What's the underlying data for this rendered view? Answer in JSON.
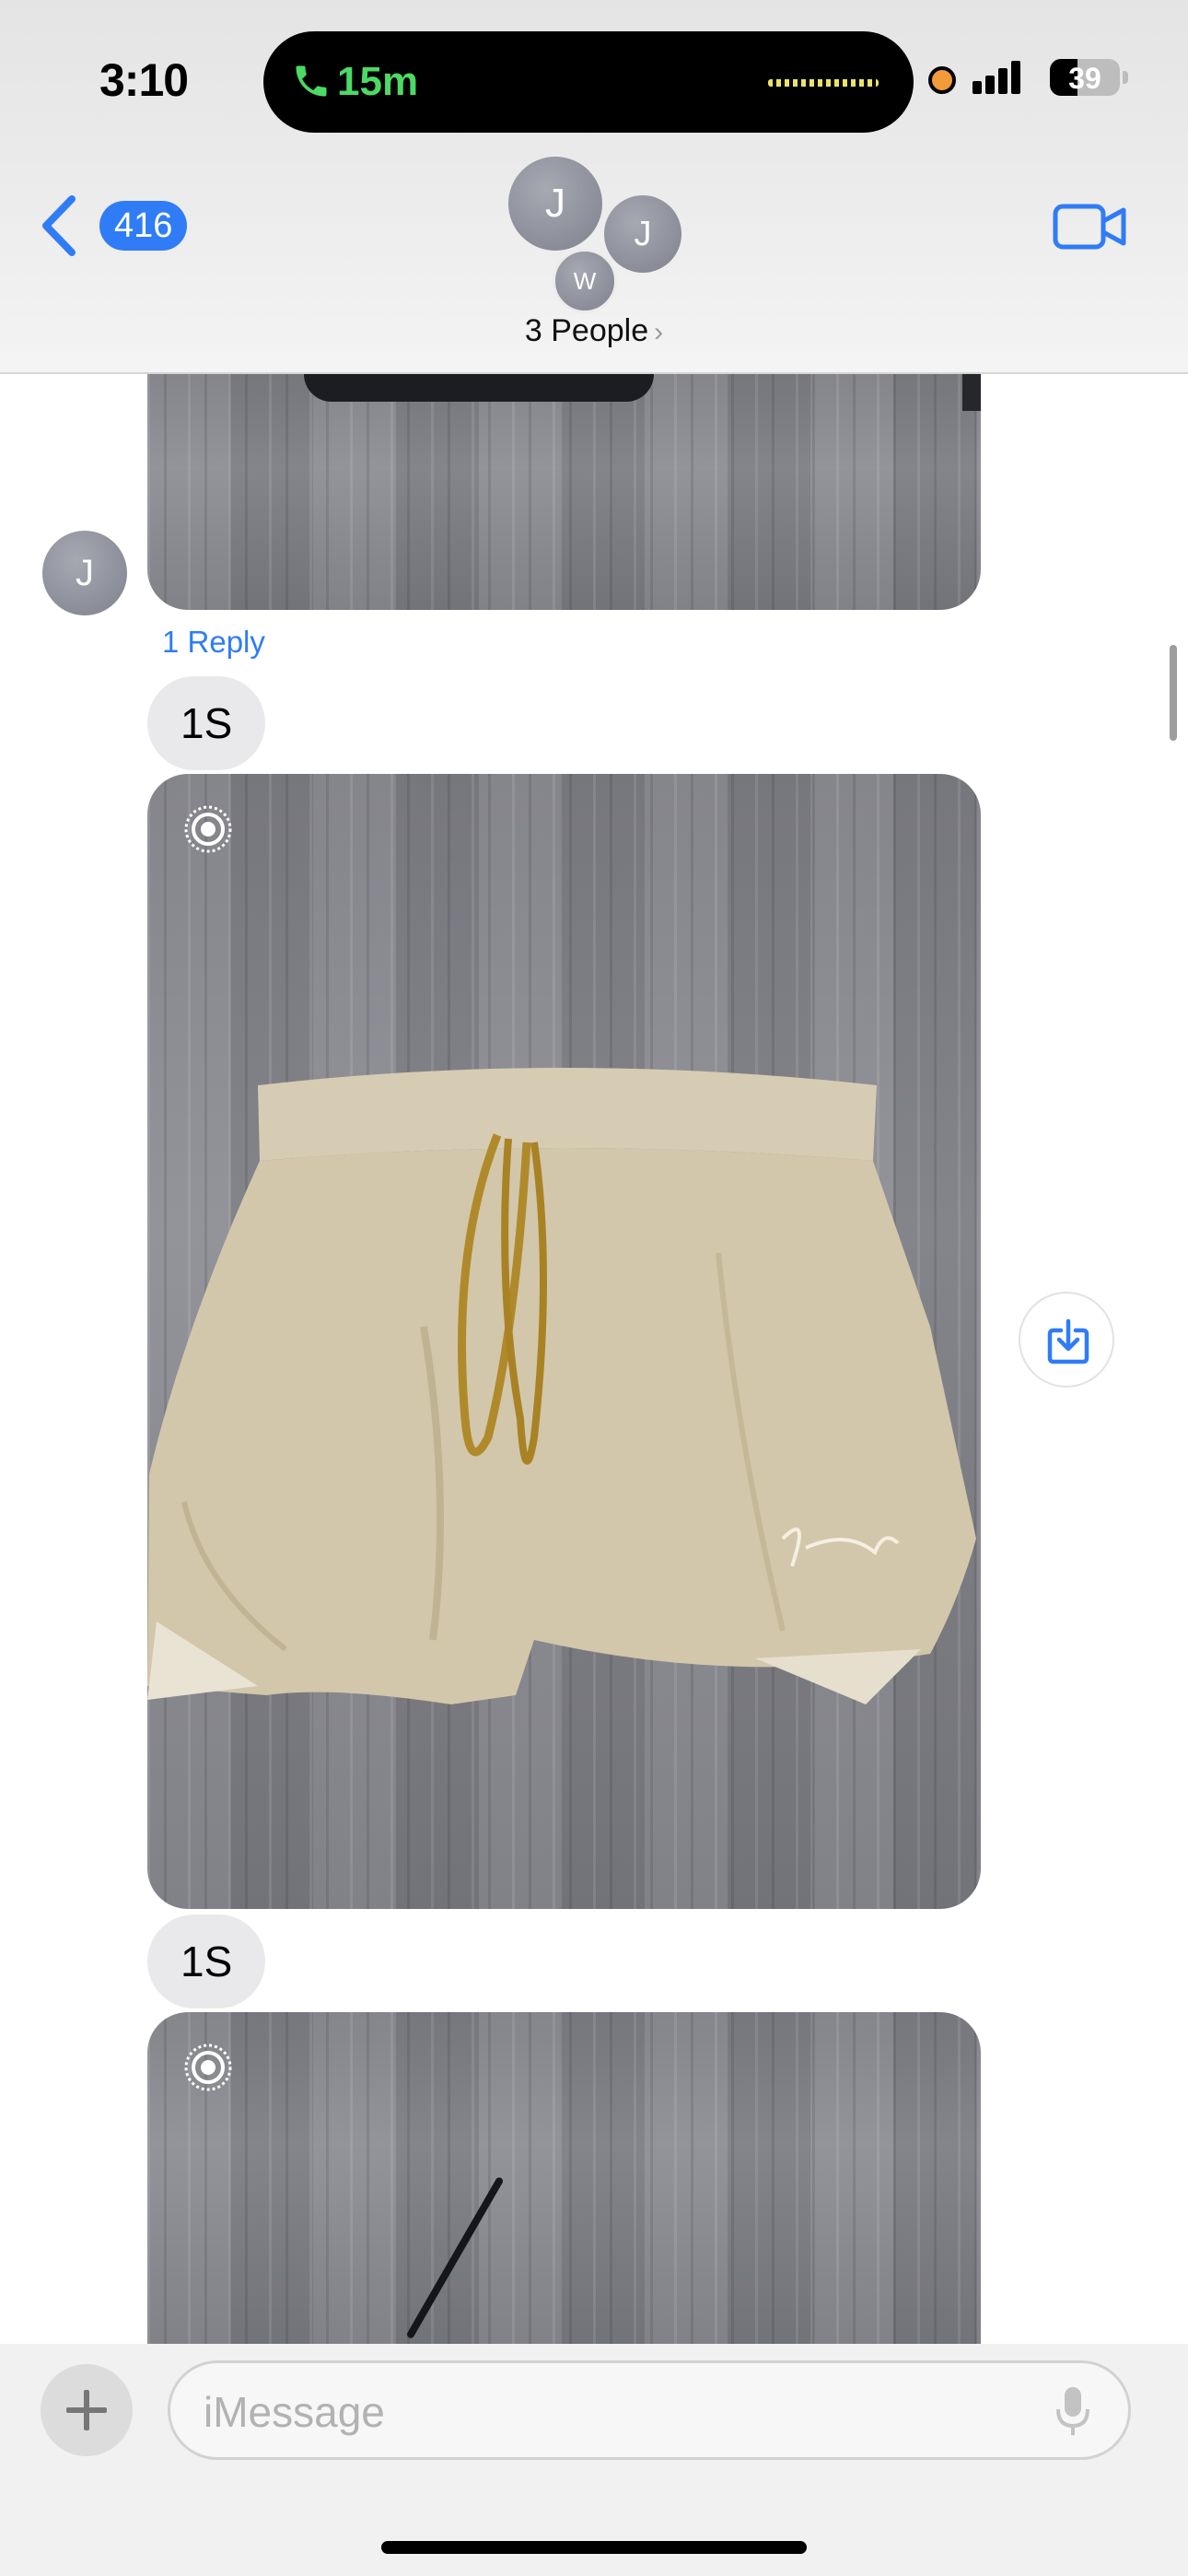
{
  "status_bar": {
    "time": "3:10",
    "call_duration": "15m",
    "battery_percent": "39",
    "battery_level": 0.39,
    "call_color": "#4cd964",
    "recording_dot_color": "#f29b38"
  },
  "header": {
    "back_count": "416",
    "participants": [
      {
        "initial": "J"
      },
      {
        "initial": "J"
      },
      {
        "initial": "W"
      }
    ],
    "group_label": "3 People",
    "accent_color": "#2f7cf6"
  },
  "messages": {
    "sender_initial": "J",
    "reply_label": "1 Reply",
    "text_1": "1S",
    "text_2": "1S"
  },
  "composer": {
    "placeholder": "iMessage"
  },
  "icons": [
    "phone-icon",
    "back-chevron-icon",
    "video-camera-icon",
    "live-photo-icon",
    "save-icon",
    "plus-icon",
    "microphone-icon"
  ]
}
